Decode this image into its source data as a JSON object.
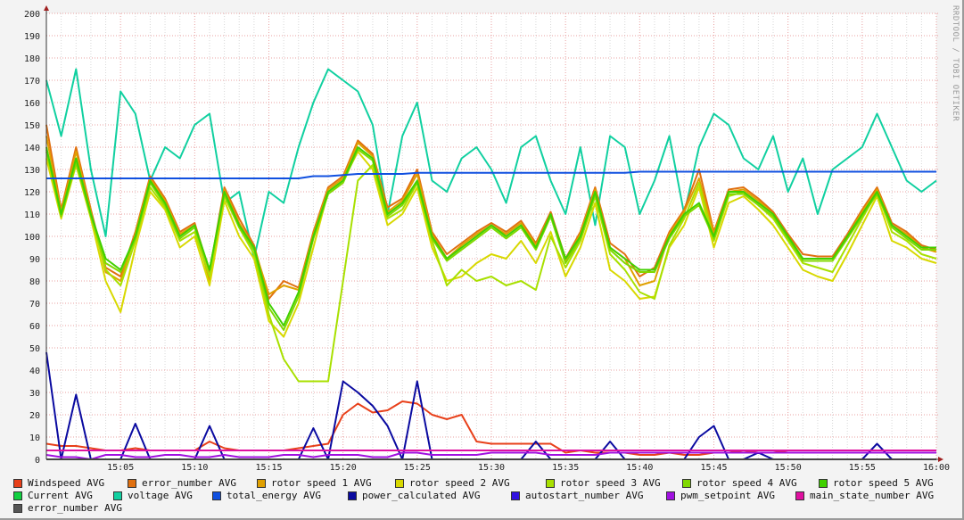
{
  "chart_data": {
    "type": "line",
    "title": "",
    "xlabel": "",
    "ylabel": "",
    "ylim": [
      0,
      200
    ],
    "y_ticks": [
      "0",
      "10",
      "20",
      "30",
      "40",
      "50",
      "60",
      "70",
      "80",
      "90",
      "100",
      "110",
      "120",
      "130",
      "140",
      "150",
      "160",
      "170",
      "180",
      "190",
      "200"
    ],
    "x_range_minutes": [
      0,
      60
    ],
    "x_ticks": [
      {
        "label": "15:05",
        "minute": 5
      },
      {
        "label": "15:10",
        "minute": 10
      },
      {
        "label": "15:15",
        "minute": 15
      },
      {
        "label": "15:20",
        "minute": 20
      },
      {
        "label": "15:25",
        "minute": 25
      },
      {
        "label": "15:30",
        "minute": 30
      },
      {
        "label": "15:35",
        "minute": 35
      },
      {
        "label": "15:40",
        "minute": 40
      },
      {
        "label": "15:45",
        "minute": 45
      },
      {
        "label": "15:50",
        "minute": 50
      },
      {
        "label": "15:55",
        "minute": 55
      },
      {
        "label": "16:00",
        "minute": 60
      }
    ],
    "grid": true,
    "legend_placement": "bottom",
    "watermark": "RRDTOOL / TOBI OETIKER",
    "series": [
      {
        "name": "Windspeed AVG",
        "color": "#e8401a",
        "values": [
          7,
          6,
          6,
          5,
          4,
          4,
          5,
          4,
          4,
          4,
          4,
          8,
          5,
          4,
          4,
          4,
          4,
          5,
          6,
          7,
          20,
          25,
          21,
          22,
          26,
          25,
          20,
          18,
          20,
          8,
          7,
          7,
          7,
          7,
          7,
          3,
          4,
          3,
          3,
          3,
          2,
          2,
          3,
          2,
          2,
          3,
          3,
          4,
          3,
          3,
          4,
          4,
          4,
          4,
          4,
          4,
          4,
          4,
          4,
          4,
          4
        ]
      },
      {
        "name": "error_number AVG",
        "color": "#e07010",
        "values": [
          150,
          112,
          140,
          112,
          86,
          82,
          102,
          127,
          117,
          102,
          106,
          84,
          122,
          108,
          96,
          72,
          80,
          77,
          102,
          122,
          127,
          143,
          137,
          113,
          117,
          130,
          102,
          92,
          97,
          102,
          106,
          102,
          107,
          97,
          111,
          90,
          102,
          122,
          97,
          92,
          82,
          86,
          102,
          112,
          130,
          102,
          121,
          122,
          117,
          111,
          101,
          92,
          91,
          91,
          101,
          112,
          122,
          106,
          102,
          96,
          94
        ]
      },
      {
        "name": "rotor speed 1 AVG",
        "color": "#e0a000",
        "values": [
          145,
          111,
          138,
          111,
          84,
          80,
          101,
          126,
          116,
          101,
          105,
          80,
          121,
          106,
          95,
          74,
          78,
          76,
          101,
          121,
          126,
          142,
          136,
          111,
          116,
          128,
          101,
          90,
          96,
          101,
          105,
          101,
          106,
          96,
          110,
          89,
          101,
          121,
          95,
          90,
          78,
          80,
          101,
          111,
          126,
          101,
          120,
          121,
          116,
          110,
          100,
          90,
          90,
          90,
          100,
          111,
          121,
          105,
          101,
          95,
          93
        ]
      },
      {
        "name": "rotor speed 2 AVG",
        "color": "#d8d800",
        "values": [
          135,
          108,
          132,
          108,
          80,
          66,
          95,
          120,
          112,
          95,
          100,
          78,
          116,
          100,
          90,
          62,
          55,
          70,
          95,
          120,
          125,
          138,
          130,
          105,
          110,
          122,
          95,
          80,
          82,
          88,
          92,
          90,
          98,
          88,
          102,
          82,
          95,
          115,
          85,
          80,
          72,
          73,
          95,
          105,
          122,
          95,
          115,
          118,
          112,
          105,
          95,
          85,
          82,
          80,
          92,
          105,
          118,
          98,
          95,
          90,
          88
        ]
      },
      {
        "name": "rotor speed 3 AVG",
        "color": "#a8e000",
        "values": [
          138,
          110,
          134,
          110,
          85,
          78,
          98,
          122,
          113,
          98,
          102,
          82,
          118,
          104,
          92,
          65,
          45,
          35,
          35,
          35,
          80,
          125,
          132,
          108,
          112,
          124,
          98,
          78,
          85,
          80,
          82,
          78,
          80,
          76,
          100,
          86,
          98,
          118,
          92,
          85,
          75,
          72,
          96,
          108,
          124,
          98,
          118,
          120,
          114,
          108,
          98,
          88,
          86,
          84,
          96,
          108,
          120,
          102,
          98,
          92,
          90
        ]
      },
      {
        "name": "rotor speed 4 AVG",
        "color": "#80d800",
        "values": [
          139,
          109,
          133,
          109,
          88,
          84,
          99,
          124,
          114,
          99,
          104,
          85,
          119,
          104,
          94,
          68,
          58,
          73,
          99,
          119,
          124,
          139,
          134,
          109,
          114,
          124,
          99,
          89,
          94,
          99,
          104,
          99,
          104,
          94,
          109,
          88,
          99,
          119,
          94,
          88,
          84,
          84,
          99,
          109,
          114,
          99,
          119,
          119,
          114,
          109,
          99,
          89,
          89,
          89,
          99,
          109,
          119,
          104,
          99,
          94,
          94
        ]
      },
      {
        "name": "rotor speed 5 AVG",
        "color": "#40d000",
        "values": [
          140,
          110,
          135,
          110,
          90,
          85,
          100,
          125,
          115,
          100,
          105,
          85,
          120,
          105,
          95,
          70,
          60,
          75,
          100,
          120,
          125,
          140,
          135,
          110,
          115,
          125,
          100,
          90,
          95,
          100,
          105,
          100,
          105,
          95,
          110,
          90,
          100,
          120,
          95,
          90,
          85,
          85,
          100,
          110,
          115,
          100,
          120,
          120,
          115,
          110,
          100,
          90,
          90,
          90,
          100,
          110,
          120,
          105,
          100,
          95,
          95
        ]
      },
      {
        "name": "Current AVG",
        "color": "#10d040",
        "values": [
          0,
          0,
          0,
          0,
          0,
          0,
          0,
          0,
          0,
          0,
          0,
          0,
          0,
          0,
          0,
          0,
          0,
          0,
          0,
          0,
          0,
          0,
          0,
          0,
          0,
          0,
          0,
          0,
          0,
          0,
          0,
          0,
          0,
          0,
          0,
          0,
          0,
          0,
          0,
          0,
          0,
          0,
          0,
          0,
          0,
          0,
          0,
          0,
          0,
          0,
          0,
          0,
          0,
          0,
          0,
          0,
          0,
          0,
          0,
          0,
          0
        ]
      },
      {
        "name": "voltage AVG",
        "color": "#10d0a0",
        "values": [
          170,
          145,
          175,
          130,
          100,
          165,
          155,
          125,
          140,
          135,
          150,
          155,
          115,
          120,
          90,
          120,
          115,
          140,
          160,
          175,
          170,
          165,
          150,
          110,
          145,
          160,
          125,
          120,
          135,
          140,
          130,
          115,
          140,
          145,
          125,
          110,
          140,
          105,
          145,
          140,
          110,
          125,
          145,
          110,
          140,
          155,
          150,
          135,
          130,
          145,
          120,
          135,
          110,
          130,
          135,
          140,
          155,
          140,
          125,
          120,
          125
        ]
      },
      {
        "name": "total_energy AVG",
        "color": "#1050e0",
        "values": [
          126,
          126,
          126,
          126,
          126,
          126,
          126,
          126,
          126,
          126,
          126,
          126,
          126,
          126,
          126,
          126,
          126,
          126,
          127,
          127,
          127.5,
          128,
          128,
          128,
          128,
          128.5,
          128.5,
          128.5,
          128.5,
          128.5,
          128.5,
          128.5,
          128.5,
          128.5,
          128.5,
          128.5,
          128.5,
          128.5,
          128.5,
          128.5,
          129,
          129,
          129,
          129,
          129,
          129,
          129,
          129,
          129,
          129,
          129,
          129,
          129,
          129,
          129,
          129,
          129,
          129,
          129,
          129,
          129
        ]
      },
      {
        "name": "power_calculated AVG",
        "color": "#0a0aa0",
        "values": [
          48,
          0,
          29,
          0,
          0,
          0,
          16,
          0,
          0,
          0,
          0,
          15,
          0,
          0,
          0,
          0,
          0,
          0,
          14,
          0,
          35,
          30,
          24,
          15,
          0,
          35,
          0,
          0,
          0,
          0,
          0,
          0,
          0,
          8,
          0,
          0,
          0,
          0,
          8,
          0,
          0,
          0,
          0,
          0,
          10,
          15,
          0,
          0,
          3,
          0,
          0,
          0,
          0,
          0,
          0,
          0,
          7,
          0,
          0,
          0,
          0
        ]
      },
      {
        "name": "autostart_number AVG",
        "color": "#3010e0",
        "values": [
          0,
          0,
          0,
          0,
          0,
          0,
          0,
          0,
          0,
          0,
          0,
          0,
          0,
          0,
          0,
          0,
          0,
          0,
          0,
          0,
          0,
          0,
          0,
          0,
          0,
          0,
          0,
          0,
          0,
          0,
          0,
          0,
          0,
          0,
          0,
          0,
          0,
          0,
          0,
          0,
          0,
          0,
          0,
          0,
          0,
          0,
          0,
          0,
          0,
          0,
          0,
          0,
          0,
          0,
          0,
          0,
          0,
          0,
          0,
          0,
          0
        ]
      },
      {
        "name": "pwm_setpoint AVG",
        "color": "#a010e0",
        "values": [
          2,
          1,
          1,
          0,
          2,
          2,
          1,
          1,
          2,
          2,
          1,
          1,
          2,
          1,
          1,
          1,
          2,
          2,
          1,
          2,
          2,
          2,
          1,
          1,
          3,
          3,
          2,
          2,
          2,
          2,
          3,
          3,
          3,
          3,
          2,
          2,
          2,
          2,
          3,
          3,
          3,
          3,
          3,
          3,
          3,
          3,
          3,
          3,
          3,
          3,
          3,
          3,
          3,
          3,
          3,
          3,
          3,
          3,
          3,
          3,
          3
        ]
      },
      {
        "name": "main_state_number AVG",
        "color": "#e010a0",
        "values": [
          4,
          4,
          4,
          4,
          4,
          4,
          4,
          4,
          4,
          4,
          4,
          4,
          4,
          4,
          4,
          4,
          4,
          4,
          4,
          4,
          4,
          4,
          4,
          4,
          4,
          4,
          4,
          4,
          4,
          4,
          4,
          4,
          4,
          4,
          4,
          4,
          4,
          4,
          4,
          4,
          4,
          4,
          4,
          4,
          4,
          4,
          4,
          4,
          4,
          4,
          4,
          4,
          4,
          4,
          4,
          4,
          4,
          4,
          4,
          4,
          4
        ]
      },
      {
        "name": "error_number AVG",
        "color": "#555555",
        "values": [
          0,
          0,
          0,
          0,
          0,
          0,
          0,
          0,
          0,
          0,
          0,
          0,
          0,
          0,
          0,
          0,
          0,
          0,
          0,
          0,
          0,
          0,
          0,
          0,
          0,
          0,
          0,
          0,
          0,
          0,
          0,
          0,
          0,
          0,
          0,
          0,
          0,
          0,
          0,
          0,
          0,
          0,
          0,
          0,
          0,
          0,
          0,
          0,
          0,
          0,
          0,
          0,
          0,
          0,
          0,
          0,
          0,
          0,
          0,
          0,
          0
        ]
      }
    ]
  }
}
